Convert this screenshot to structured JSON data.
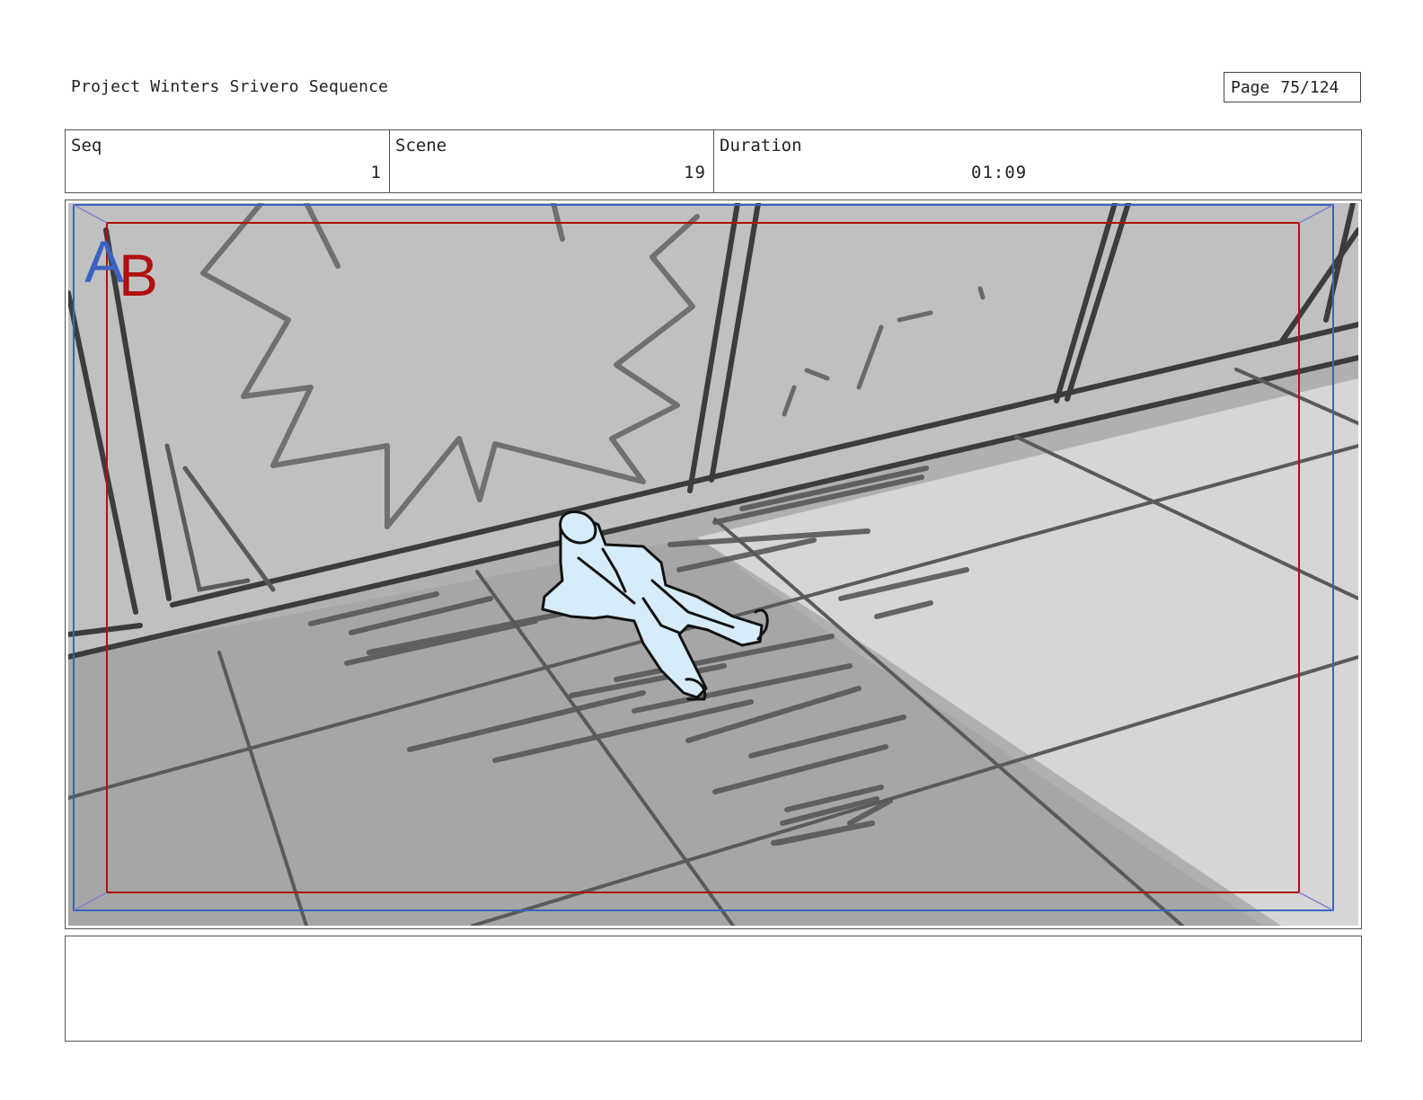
{
  "header": {
    "project_title": "Project Winters Srivero Sequence",
    "page_label": "Page",
    "page_value": "75/124"
  },
  "info": {
    "seq_label": "Seq",
    "seq_value": "1",
    "scene_label": "Scene",
    "scene_value": "19",
    "duration_label": "Duration",
    "duration_value": "01:09"
  },
  "panel": {
    "safe_marker_a": "A",
    "safe_marker_b": "B",
    "colors": {
      "outer_guide": "#3a62c0",
      "inner_guide": "#b01010",
      "figure_fill": "#d7ecfa"
    }
  },
  "notes": {
    "text": ""
  }
}
